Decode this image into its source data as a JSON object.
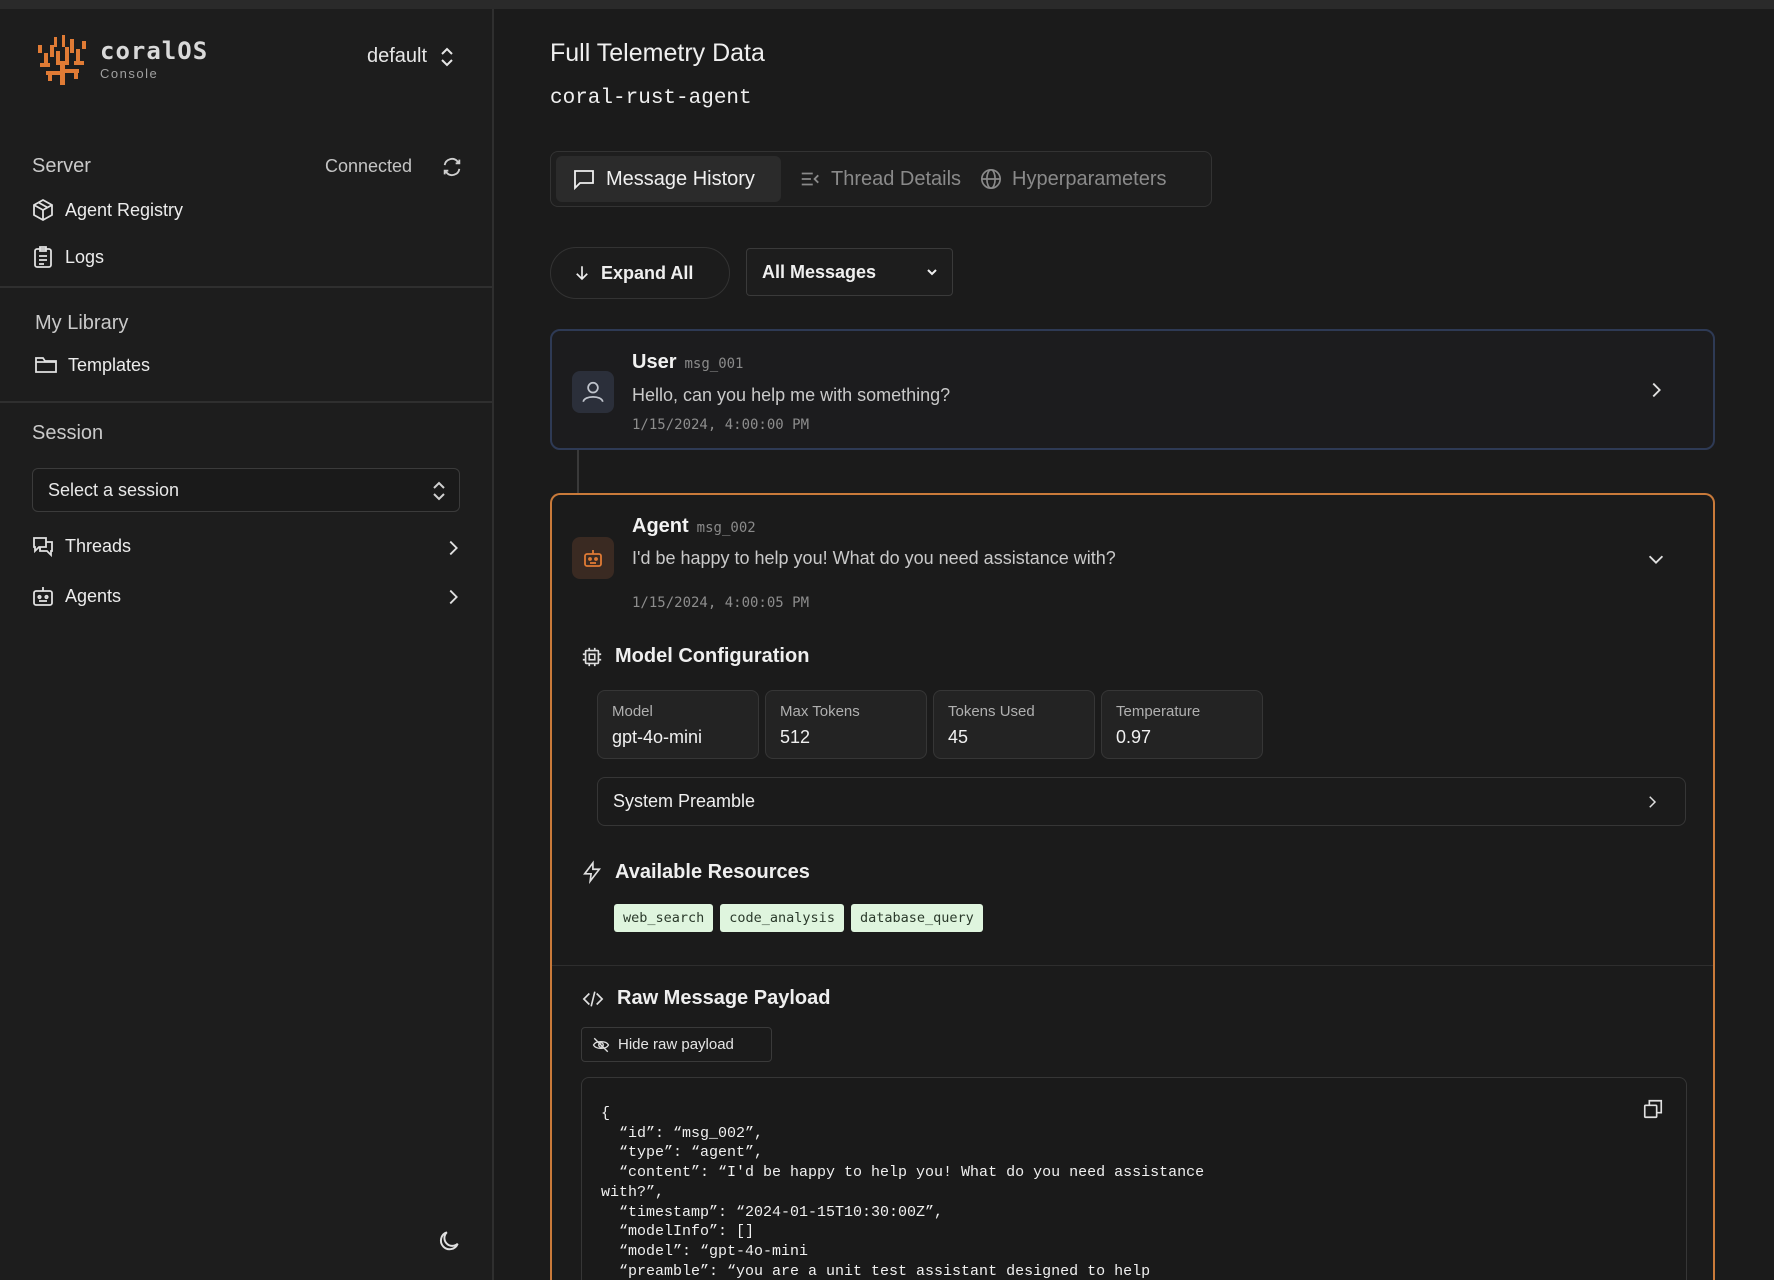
{
  "brand": {
    "name": "coralOS",
    "subtitle": "Console",
    "accent": "#e07b35"
  },
  "environment": {
    "label": "default"
  },
  "sidebar": {
    "server": {
      "title": "Server",
      "status": "Connected",
      "items": [
        {
          "label": "Agent Registry",
          "icon": "package-icon"
        },
        {
          "label": "Logs",
          "icon": "clipboard-icon"
        }
      ]
    },
    "library": {
      "title": "My Library",
      "items": [
        {
          "label": "Templates",
          "icon": "folder-icon"
        }
      ]
    },
    "session": {
      "title": "Session",
      "select_placeholder": "Select a session",
      "items": [
        {
          "label": "Threads",
          "icon": "chat-icon"
        },
        {
          "label": "Agents",
          "icon": "bot-icon"
        }
      ]
    }
  },
  "main": {
    "title": "Full Telemetry Data",
    "agent_id": "coral-rust-agent",
    "tabs": [
      {
        "label": "Message History",
        "active": true
      },
      {
        "label": "Thread Details",
        "active": false
      },
      {
        "label": "Hyperparameters",
        "active": false
      }
    ],
    "expand_label": "Expand All",
    "filter": {
      "selected": "All Messages"
    },
    "messages": [
      {
        "role": "User",
        "id": "msg_001",
        "text": "Hello, can you help me with something?",
        "timestamp": "1/15/2024, 4:00:00 PM",
        "border": "#2e3a55"
      },
      {
        "role": "Agent",
        "id": "msg_002",
        "text": "I'd be happy to help you! What do you need assistance with?",
        "timestamp": "1/15/2024, 4:00:05 PM",
        "border": "#c97a3a",
        "model_config": {
          "title": "Model Configuration",
          "stats": [
            {
              "label": "Model",
              "value": "gpt-4o-mini"
            },
            {
              "label": "Max Tokens",
              "value": "512"
            },
            {
              "label": "Tokens Used",
              "value": "45"
            },
            {
              "label": "Temperature",
              "value": "0.97"
            }
          ],
          "preamble_label": "System Preamble"
        },
        "resources": {
          "title": "Available Resources",
          "chips": [
            "web_search",
            "code_analysis",
            "database_query"
          ]
        },
        "raw": {
          "title": "Raw Message Payload",
          "hide_label": "Hide raw payload",
          "code": "{\n  “id”: “msg_002”,\n  “type”: “agent”,\n  “content”: “I'd be happy to help you! What do you need assistance\nwith?”,\n  “timestamp”: “2024-01-15T10:30:00Z”,\n  “modelInfo”: []\n  “model”: “gpt-4o-mini\n  “preamble”: “you are a unit test assistant designed to help\ndevelopers create comprehensive resources...”"
        }
      }
    ]
  }
}
